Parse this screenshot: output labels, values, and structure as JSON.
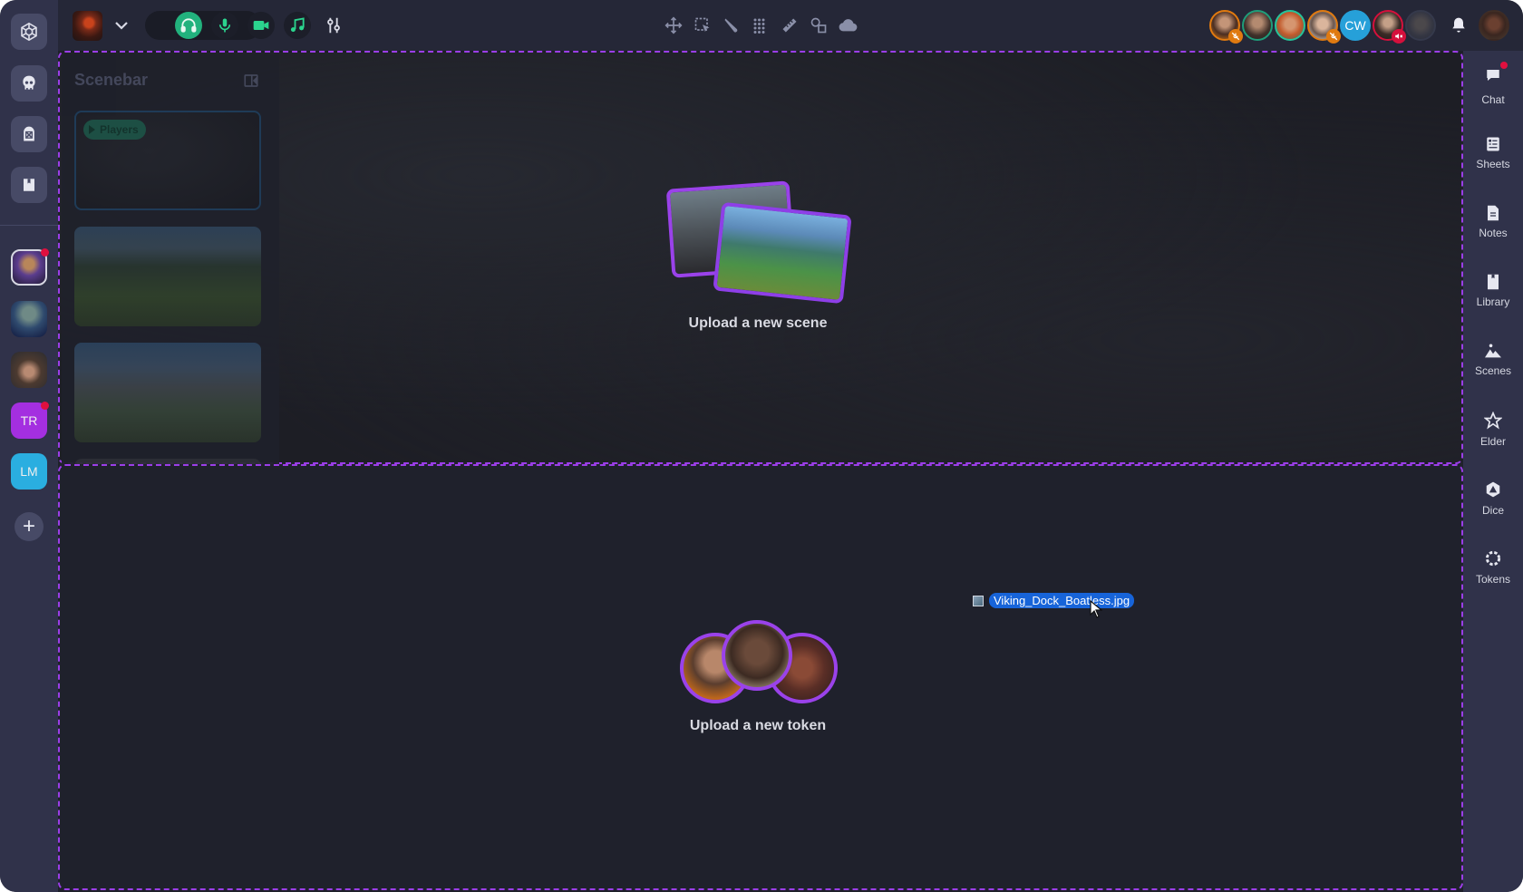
{
  "app": {
    "top_bar": {
      "game_menu_icon": "chevron-down-icon",
      "voice": {
        "headphones": {
          "icon": "headphones-icon",
          "active": true
        },
        "microphone": {
          "icon": "microphone-icon"
        },
        "camera": {
          "icon": "video-camera-icon"
        },
        "music": {
          "icon": "music-note-icon"
        },
        "settings": {
          "icon": "sliders-icon"
        }
      },
      "tools": [
        {
          "name": "move",
          "icon": "move-arrows-icon"
        },
        {
          "name": "select",
          "icon": "selection-box-icon"
        },
        {
          "name": "brush",
          "icon": "brush-icon"
        },
        {
          "name": "grid",
          "icon": "grid-dots-icon"
        },
        {
          "name": "ruler",
          "icon": "ruler-icon"
        },
        {
          "name": "shapes",
          "icon": "shapes-icon"
        },
        {
          "name": "fog",
          "icon": "cloud-icon"
        }
      ],
      "participants": [
        {
          "name": "participant-1",
          "ring": "#e07a10",
          "status": "muted-deafened",
          "badge_color": "#e07a10"
        },
        {
          "name": "participant-2",
          "ring": "#1f9d7a",
          "status": "online"
        },
        {
          "name": "participant-3",
          "ring": "#25c49a",
          "status": "speaking"
        },
        {
          "name": "participant-4",
          "ring": "#e07a10",
          "status": "muted-deafened",
          "badge_color": "#e07a10"
        },
        {
          "name": "participant-cw",
          "initials": "CW",
          "bg": "#26a0d9",
          "status": "online"
        },
        {
          "name": "participant-6",
          "ring": "#d5103c",
          "status": "muted",
          "badge_color": "#d5103c"
        },
        {
          "name": "participant-7",
          "ring": "#3c4154",
          "status": "away"
        }
      ],
      "notifications_icon": "bell-icon"
    },
    "left_rail": {
      "items": [
        {
          "name": "logo",
          "icon": "hexagon-aperture-icon"
        },
        {
          "name": "monsters",
          "icon": "skull-icon"
        },
        {
          "name": "characters",
          "icon": "tombstone-icon"
        },
        {
          "name": "compendium",
          "icon": "book-icon"
        }
      ],
      "games": [
        {
          "name": "game-1",
          "notification": true,
          "selected": true
        },
        {
          "name": "game-2",
          "notification": false
        },
        {
          "name": "game-3",
          "notification": false
        },
        {
          "name": "game-tr",
          "initials": "TR",
          "bg": "#a42fe0",
          "notification": true
        },
        {
          "name": "game-lm",
          "initials": "LM",
          "bg": "#2aaee0",
          "notification": false
        }
      ],
      "add_label": "+"
    },
    "scenebar": {
      "title": "Scenebar",
      "players_label": "Players",
      "scenes": [
        "players-scene",
        "village-hills",
        "cliff-cave"
      ]
    },
    "upload_scene": {
      "label": "Upload a new scene"
    },
    "upload_token": {
      "label": "Upload a new token"
    },
    "dragged_file": {
      "name": "Viking_Dock_Boatless.jpg"
    },
    "right_rail": [
      {
        "label": "Chat",
        "icon": "chat-bubble-icon",
        "notification": true
      },
      {
        "label": "Sheets",
        "icon": "sheet-icon"
      },
      {
        "label": "Notes",
        "icon": "note-icon"
      },
      {
        "label": "Library",
        "icon": "bookmark-icon"
      },
      {
        "label": "Scenes",
        "icon": "mountain-icon"
      },
      {
        "label": "Elder",
        "icon": "star-icon"
      },
      {
        "label": "Dice",
        "icon": "dice-icon"
      },
      {
        "label": "Tokens",
        "icon": "tokens-icon"
      }
    ],
    "colors": {
      "accent_purple": "#9b3ee8",
      "voice_green": "#2bd48e",
      "alert_red": "#e0103f",
      "file_highlight": "#1764d9"
    }
  }
}
